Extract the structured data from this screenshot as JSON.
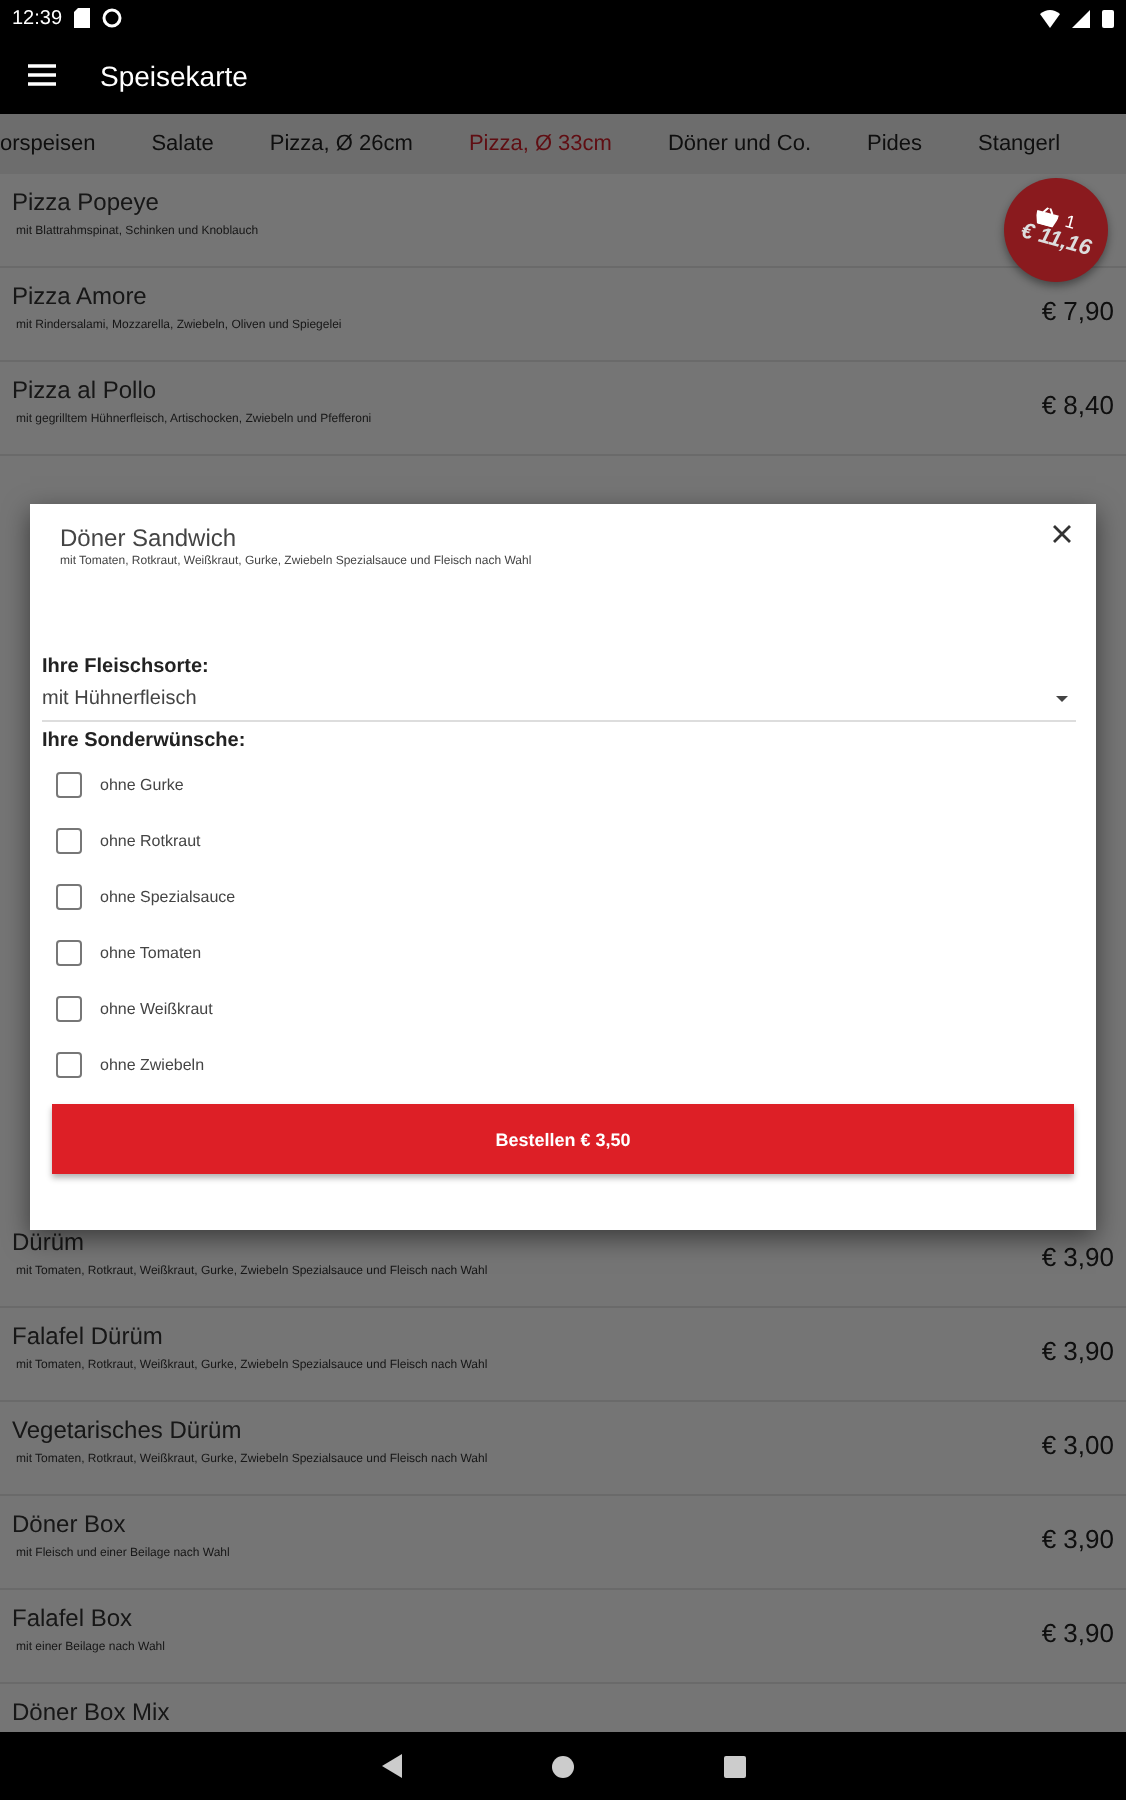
{
  "status_bar": {
    "time": "12:39"
  },
  "app_bar": {
    "title": "Speisekarte"
  },
  "tabs": [
    {
      "label": "orspeisen",
      "selected": false
    },
    {
      "label": "Salate",
      "selected": false
    },
    {
      "label": "Pizza, Ø 26cm",
      "selected": false
    },
    {
      "label": "Pizza, Ø 33cm",
      "selected": true
    },
    {
      "label": "Döner und Co.",
      "selected": false
    },
    {
      "label": "Pides",
      "selected": false
    },
    {
      "label": "Stangerl",
      "selected": false
    }
  ],
  "cart_badge": {
    "count": "1",
    "total": "€ 11,16"
  },
  "menu_top": [
    {
      "name": "Pizza Popeye",
      "description": "mit Blattrahmspinat, Schinken und Knoblauch"
    },
    {
      "name": "Pizza Amore",
      "description": "mit Rindersalami, Mozzarella, Zwiebeln, Oliven und Spiegelei",
      "price": "€ 7,90"
    },
    {
      "name": "Pizza al Pollo",
      "description": "mit gegrilltem Hühnerfleisch, Artischocken, Zwiebeln und Pfefferoni",
      "price": "€ 8,40"
    }
  ],
  "menu_bottom": [
    {
      "name": "Dürüm",
      "description": "mit Tomaten, Rotkraut, Weißkraut, Gurke, Zwiebeln Spezialsauce und Fleisch nach Wahl",
      "price": "€ 3,90"
    },
    {
      "name": "Falafel Dürüm",
      "description": "mit Tomaten, Rotkraut, Weißkraut, Gurke, Zwiebeln Spezialsauce und Fleisch nach Wahl",
      "price": "€ 3,90"
    },
    {
      "name": "Vegetarisches Dürüm",
      "description": "mit Tomaten, Rotkraut, Weißkraut, Gurke, Zwiebeln Spezialsauce und Fleisch nach Wahl",
      "price": "€ 3,00"
    },
    {
      "name": "Döner Box",
      "description": "mit Fleisch und einer Beilage nach Wahl",
      "price": "€ 3,90"
    },
    {
      "name": "Falafel Box",
      "description": "mit einer Beilage nach Wahl",
      "price": "€ 3,90"
    },
    {
      "name": "Döner Box Mix"
    }
  ],
  "dialog": {
    "title": "Döner Sandwich",
    "subtitle": "mit Tomaten, Rotkraut, Weißkraut, Gurke, Zwiebeln Spezialsauce und Fleisch nach Wahl",
    "meat_label": "Ihre Fleischsorte:",
    "meat_value": "mit Hühnerfleisch",
    "extras_label": "Ihre Sonderwünsche:",
    "extras": [
      {
        "label": "ohne Gurke",
        "checked": false
      },
      {
        "label": "ohne Rotkraut",
        "checked": false
      },
      {
        "label": "ohne Spezialsauce",
        "checked": false
      },
      {
        "label": "ohne Tomaten",
        "checked": false
      },
      {
        "label": "ohne Weißkraut",
        "checked": false
      },
      {
        "label": "ohne Zwiebeln",
        "checked": false
      }
    ],
    "order_button": "Bestellen € 3,50"
  }
}
